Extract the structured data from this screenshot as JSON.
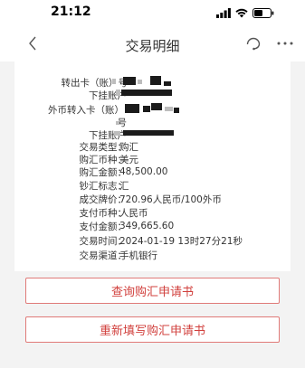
{
  "status": {
    "time": "21:12"
  },
  "nav": {
    "title": "交易明细"
  },
  "rows": [
    {
      "label": "转出卡（账）号",
      "value": ""
    },
    {
      "label": "下挂账户",
      "value": ""
    },
    {
      "label": "外币转入卡（账）",
      "value": ""
    },
    {
      "label": "号",
      "value": ""
    },
    {
      "label": "下挂账户",
      "value": ""
    },
    {
      "label": "交易类型：",
      "value": "购汇"
    },
    {
      "label": "购汇币种：",
      "value": "美元"
    },
    {
      "label": "购汇金额：",
      "value": "48,500.00"
    },
    {
      "label": "钞汇标志：",
      "value": "汇"
    },
    {
      "label": "成交牌价：",
      "value": "720.96人民币/100外币"
    },
    {
      "label": "支付币种：",
      "value": "人民币"
    },
    {
      "label": "支付金额：",
      "value": "349,665.60"
    },
    {
      "label": "交易时间：",
      "value": "2024-01-19 13时27分21秒"
    },
    {
      "label": "交易渠道：",
      "value": "手机银行"
    }
  ],
  "buttons": {
    "query": "查询购汇申请书",
    "refill": "重新填写购汇申请书"
  },
  "colors": {
    "accent": "#d1403d",
    "background": "#f3f3f3"
  }
}
